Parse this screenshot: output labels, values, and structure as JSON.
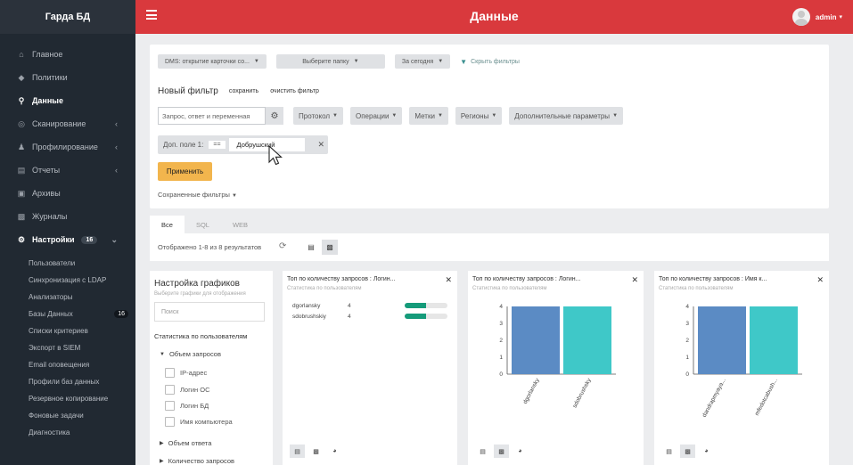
{
  "sidebar": {
    "brand": "Гарда БД",
    "items": [
      {
        "label": "Главное",
        "icon": "home-icon"
      },
      {
        "label": "Политики",
        "icon": "shield-icon"
      },
      {
        "label": "Данные",
        "icon": "search-icon",
        "active": true
      },
      {
        "label": "Сканирование",
        "icon": "target-icon",
        "chevron": true
      },
      {
        "label": "Профилирование",
        "icon": "users-icon",
        "chevron": true
      },
      {
        "label": "Отчеты",
        "icon": "chart-icon",
        "chevron": true
      },
      {
        "label": "Архивы",
        "icon": "archive-icon"
      },
      {
        "label": "Журналы",
        "icon": "file-icon"
      },
      {
        "label": "Настройки",
        "icon": "gear-icon",
        "badge": "16",
        "chevron": true
      }
    ],
    "sub_items": [
      {
        "label": "Пользователи"
      },
      {
        "label": "Синхронизация с LDAP"
      },
      {
        "label": "Анализаторы"
      },
      {
        "label": "Базы Данных",
        "badge": "16"
      },
      {
        "label": "Списки критериев"
      },
      {
        "label": "Экспорт в SIEM"
      },
      {
        "label": "Email оповещения"
      },
      {
        "label": "Профили баз данных"
      },
      {
        "label": "Резервное копирование"
      },
      {
        "label": "Фоновые задачи"
      },
      {
        "label": "Диагностика"
      }
    ]
  },
  "topbar": {
    "title": "Данные",
    "user": "admin"
  },
  "query": {
    "card_select": "DMS: открытие карточки со...",
    "folder_select": "Выберите папку",
    "period_select": "За сегодня",
    "hide_filters": "Скрыть фильтры"
  },
  "filter": {
    "title": "Новый фильтр",
    "save": "сохранить",
    "clear": "очистить фильтр",
    "search_placeholder": "Запрос, ответ и переменная",
    "dropdowns": [
      "Протокол",
      "Операции",
      "Метки",
      "Регионы",
      "Дополнительные параметры"
    ],
    "add_field_label": "Доп. поле 1:",
    "add_field_op": "==",
    "add_field_value": "Добрушский",
    "apply": "Применить",
    "saved_filters": "Сохраненные фильтры"
  },
  "tabs": [
    "Все",
    "SQL",
    "WEB"
  ],
  "results": {
    "text": "Отображено 1-8 из 8 результатов"
  },
  "settings": {
    "title": "Настройка графиков",
    "subtitle": "Выберите графики для отображения",
    "search_placeholder": "Поиск",
    "section": "Статистика по пользователям",
    "group1": "Объем запросов",
    "checks": [
      "IP-адрес",
      "Логин ОС",
      "Логин БД",
      "Имя компьютера"
    ],
    "group2": "Объем ответа",
    "group3": "Количество запросов"
  },
  "cards": [
    {
      "title": "Топ по количеству запросов : Логин...",
      "subtitle": "Статистика по пользователям",
      "rows": [
        {
          "user": "dgorlansky",
          "count": "4",
          "fill": 0.5
        },
        {
          "user": "sdobrushskiy",
          "count": "4",
          "fill": 0.5
        }
      ]
    },
    {
      "title": "Топ по количеству запросов : Логин...",
      "subtitle": "Статистика по пользователям"
    },
    {
      "title": "Топ по количеству запросов : Имя к...",
      "subtitle": "Статистика по пользователям"
    }
  ],
  "chart_data": [
    {
      "type": "bar",
      "categories": [
        "dgorlansky",
        "sdobrushsky"
      ],
      "values": [
        4,
        4
      ],
      "colors": [
        "#5b8bc4",
        "#3fc8c8"
      ],
      "yticks": [
        0,
        1,
        2,
        3,
        4
      ],
      "ylim": [
        0,
        4
      ]
    },
    {
      "type": "bar",
      "categories": [
        "dandrapmyaya...",
        "mfedotcabush..."
      ],
      "values": [
        4,
        4
      ],
      "colors": [
        "#5b8bc4",
        "#3fc8c8"
      ],
      "yticks": [
        0,
        1,
        2,
        3,
        4
      ],
      "ylim": [
        0,
        4
      ]
    }
  ],
  "colors": {
    "topbar": "#d9393d",
    "sidebar": "#212932",
    "apply": "#f2b54d",
    "teal": "#159b7a"
  }
}
